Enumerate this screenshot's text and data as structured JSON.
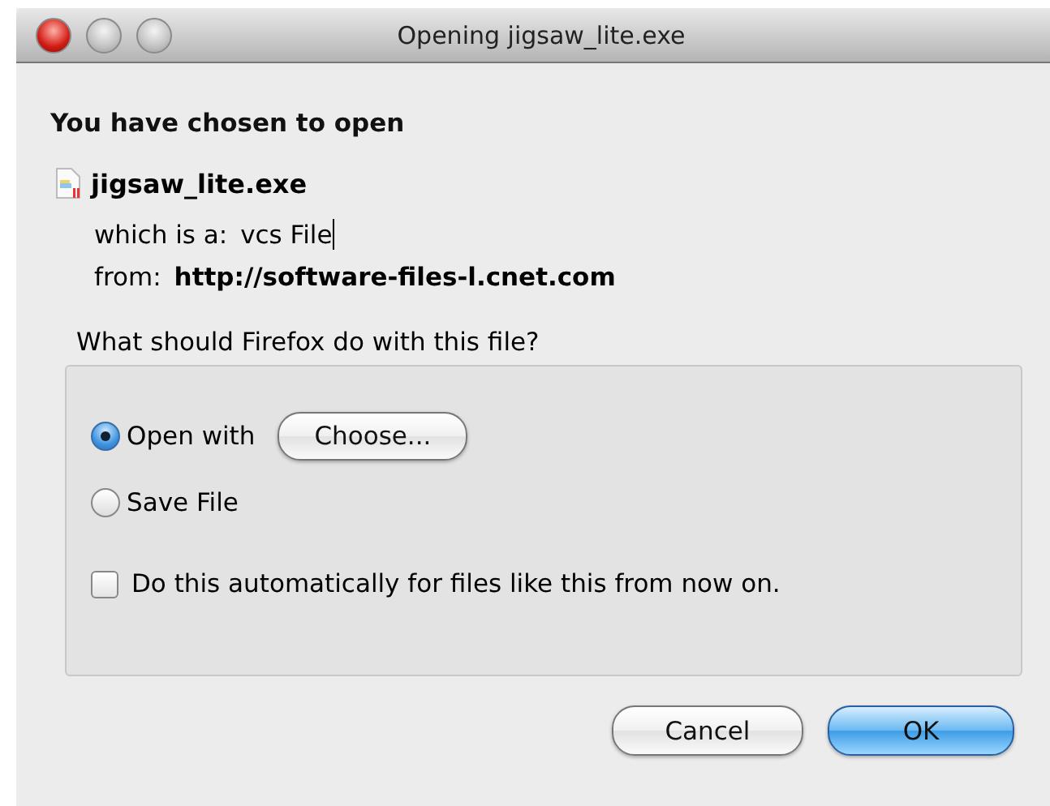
{
  "window": {
    "title": "Opening jigsaw_lite.exe"
  },
  "heading": "You have chosen to open",
  "file": {
    "name": "jigsaw_lite.exe",
    "type_label": "which is a:",
    "type_value": "vcs File",
    "from_label": "from:",
    "from_value": "http://software-files-l.cnet.com"
  },
  "question": "What should Firefox do with this file?",
  "options": [
    {
      "kind": "radio",
      "label": "Open with",
      "selected": true,
      "button": "Choose..."
    },
    {
      "kind": "radio",
      "label": "Save File",
      "selected": false
    },
    {
      "kind": "checkbox",
      "label": "Do this automatically for files like this from now on.",
      "checked": false
    }
  ],
  "buttons": [
    {
      "label": "Cancel",
      "default": false
    },
    {
      "label": "OK",
      "default": true
    }
  ]
}
